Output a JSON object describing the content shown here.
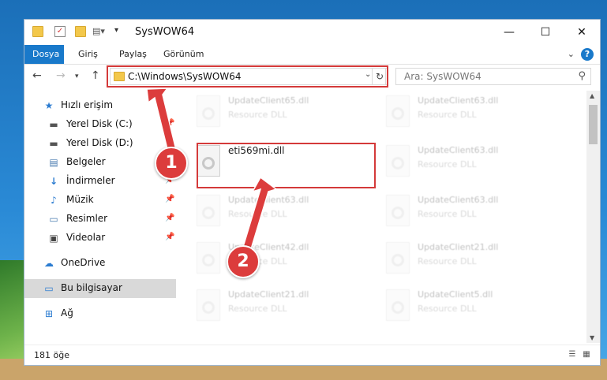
{
  "window": {
    "title": "SysWOW64"
  },
  "ribbon": {
    "tabs": [
      "Dosya",
      "Giriş",
      "Paylaş",
      "Görünüm"
    ]
  },
  "address": {
    "path": "C:\\Windows\\SysWOW64"
  },
  "search": {
    "placeholder": "Ara: SysWOW64"
  },
  "sidebar": {
    "items": [
      {
        "label": "Hızlı erişim",
        "icon": "star-icon"
      },
      {
        "label": "Yerel Disk (C:)",
        "icon": "drive-icon"
      },
      {
        "label": "Yerel Disk (D:)",
        "icon": "drive-icon"
      },
      {
        "label": "Belgeler",
        "icon": "documents-icon"
      },
      {
        "label": "İndirmeler",
        "icon": "download-icon"
      },
      {
        "label": "Müzik",
        "icon": "music-icon"
      },
      {
        "label": "Resimler",
        "icon": "pictures-icon"
      },
      {
        "label": "Videolar",
        "icon": "videos-icon"
      },
      {
        "label": "OneDrive",
        "icon": "cloud-icon"
      },
      {
        "label": "Bu bilgisayar",
        "icon": "computer-icon"
      },
      {
        "label": "Ağ",
        "icon": "network-icon"
      }
    ]
  },
  "files": {
    "left": [
      {
        "name": "UpdateClient65.dll",
        "desc": "Resource DLL"
      },
      {
        "name": "eti569mi.dll",
        "desc": ""
      },
      {
        "name": "UpdateClient63.dll",
        "desc": "Resource DLL"
      },
      {
        "name": "UpdateClient42.dll",
        "desc": "Resource DLL"
      },
      {
        "name": "UpdateClient21.dll",
        "desc": "Resource DLL"
      }
    ],
    "right": [
      {
        "name": "UpdateClient63.dll",
        "desc": "Resource DLL"
      },
      {
        "name": "UpdateClient63.dll",
        "desc": "Resource DLL"
      },
      {
        "name": "UpdateClient63.dll",
        "desc": "Resource DLL"
      },
      {
        "name": "UpdateClient21.dll",
        "desc": "Resource DLL"
      },
      {
        "name": "UpdateClient5.dll",
        "desc": "Resource DLL"
      }
    ]
  },
  "status": {
    "count": "181 öğe"
  },
  "callouts": {
    "one": "1",
    "two": "2"
  },
  "colors": {
    "accent": "#1979ca",
    "highlight": "#d43a3a"
  }
}
